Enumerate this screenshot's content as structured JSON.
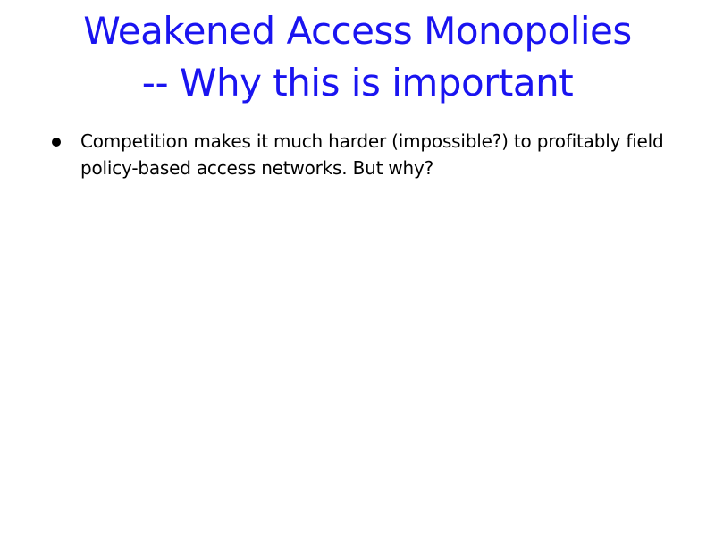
{
  "slide": {
    "title_lines": [
      "Weakened Access Monopolies",
      "-- Why this is important"
    ],
    "bullets": [
      {
        "text": "Competition makes it much harder (impossible?) to profitably field policy-based access networks.  But why?"
      }
    ]
  },
  "colors": {
    "title": "#1a14f0",
    "body_text": "#000000",
    "background": "#ffffff"
  },
  "icons": {
    "bullet": "bullet-dot"
  }
}
